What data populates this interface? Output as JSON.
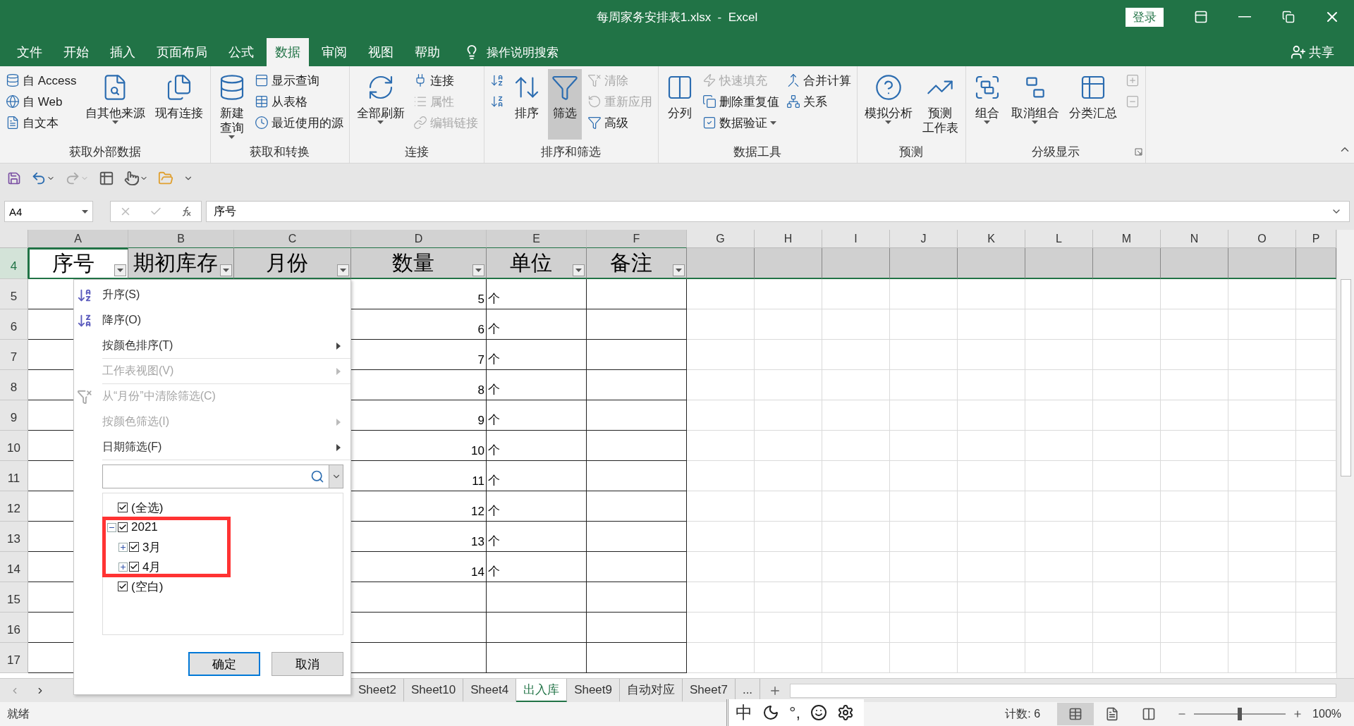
{
  "window": {
    "title": "每周家务安排表1.xlsx  -  Excel",
    "sign_in": "登录",
    "share": "共享"
  },
  "tabs": [
    {
      "label": "文件",
      "selected": false
    },
    {
      "label": "开始",
      "selected": false
    },
    {
      "label": "插入",
      "selected": false
    },
    {
      "label": "页面布局",
      "selected": false
    },
    {
      "label": "公式",
      "selected": false
    },
    {
      "label": "数据",
      "selected": true
    },
    {
      "label": "审阅",
      "selected": false
    },
    {
      "label": "视图",
      "selected": false
    },
    {
      "label": "帮助",
      "selected": false
    }
  ],
  "tell_me": "操作说明搜索",
  "ribbon": [
    {
      "name": "获取外部数据",
      "launcher": false,
      "columns": [
        {
          "kind": "stack",
          "items": [
            {
              "label": "自 Access",
              "disabled": false
            },
            {
              "label": "自 Web",
              "disabled": false
            },
            {
              "label": "自文本",
              "disabled": false
            }
          ]
        },
        {
          "kind": "large",
          "label": "自其他来源",
          "dropdown": true,
          "pressed": false,
          "disabled": false
        },
        {
          "kind": "large",
          "label": "现有连接",
          "dropdown": false,
          "pressed": false,
          "disabled": false
        }
      ]
    },
    {
      "name": "获取和转换",
      "launcher": false,
      "columns": [
        {
          "kind": "large",
          "lines": [
            "新建",
            "查询"
          ],
          "dropdown": true,
          "pressed": false,
          "disabled": false
        },
        {
          "kind": "stack",
          "items": [
            {
              "label": "显示查询",
              "disabled": false
            },
            {
              "label": "从表格",
              "disabled": false
            },
            {
              "label": "最近使用的源",
              "disabled": false
            }
          ]
        }
      ]
    },
    {
      "name": "连接",
      "launcher": false,
      "columns": [
        {
          "kind": "large",
          "label": "全部刷新",
          "dropdown": true,
          "pressed": false,
          "disabled": false
        },
        {
          "kind": "stack",
          "items": [
            {
              "label": "连接",
              "disabled": false
            },
            {
              "label": "属性",
              "disabled": true
            },
            {
              "label": "编辑链接",
              "disabled": true
            }
          ]
        }
      ]
    },
    {
      "name": "排序和筛选",
      "launcher": false,
      "columns": [
        {
          "kind": "stack",
          "items": [
            {
              "disabled": false
            },
            {
              "disabled": false
            }
          ]
        },
        {
          "kind": "large",
          "label": "排序",
          "dropdown": false,
          "pressed": false,
          "disabled": false
        },
        {
          "kind": "large",
          "label": "筛选",
          "dropdown": false,
          "pressed": true,
          "disabled": false
        },
        {
          "kind": "stack",
          "items": [
            {
              "label": "清除",
              "disabled": true
            },
            {
              "label": "重新应用",
              "disabled": true
            },
            {
              "label": "高级",
              "disabled": false
            }
          ]
        }
      ]
    },
    {
      "name": "数据工具",
      "launcher": false,
      "columns": [
        {
          "kind": "large",
          "label": "分列",
          "dropdown": false,
          "pressed": false,
          "disabled": false
        },
        {
          "kind": "stack",
          "items": [
            {
              "label": "快速填充",
              "disabled": true
            },
            {
              "label": "删除重复值",
              "disabled": false
            },
            {
              "label": "数据验证",
              "disabled": false,
              "dropdown": true
            }
          ]
        },
        {
          "kind": "stack",
          "items": [
            {
              "label": "合并计算",
              "disabled": false
            },
            {
              "label": "关系",
              "disabled": false
            }
          ]
        }
      ]
    },
    {
      "name": "预测",
      "launcher": false,
      "columns": [
        {
          "kind": "large",
          "label": "模拟分析",
          "dropdown": true,
          "pressed": false,
          "disabled": false
        },
        {
          "kind": "large",
          "lines": [
            "预测",
            "工作表"
          ],
          "dropdown": false,
          "pressed": false,
          "disabled": false
        }
      ]
    },
    {
      "name": "分级显示",
      "launcher": true,
      "columns": [
        {
          "kind": "large",
          "label": "组合",
          "dropdown": true,
          "pressed": false,
          "disabled": false
        },
        {
          "kind": "large",
          "label": "取消组合",
          "dropdown": true,
          "pressed": false,
          "disabled": false
        },
        {
          "kind": "large",
          "label": "分类汇总",
          "dropdown": false,
          "pressed": false,
          "disabled": false
        },
        {
          "kind": "stack",
          "items": [
            {
              "disabled": true
            },
            {
              "disabled": true
            }
          ]
        }
      ]
    }
  ],
  "formula_bar": {
    "name_box": "A4",
    "content": "序号"
  },
  "columns": [
    "A",
    "B",
    "C",
    "D",
    "E",
    "F",
    "G",
    "H",
    "I",
    "J",
    "K",
    "L",
    "M",
    "N",
    "O",
    "P"
  ],
  "header_row": {
    "number": "4",
    "cells": [
      {
        "text": "序号",
        "selected": true
      },
      {
        "text": "期初库存",
        "selected": false
      },
      {
        "text": "月份",
        "selected": false
      },
      {
        "text": "数量",
        "selected": false
      },
      {
        "text": "单位",
        "selected": false
      },
      {
        "text": "备注",
        "selected": false
      }
    ]
  },
  "rows": [
    {
      "number": "5",
      "quantity": "5",
      "unit": "个"
    },
    {
      "number": "6",
      "quantity": "6",
      "unit": "个"
    },
    {
      "number": "7",
      "quantity": "7",
      "unit": "个"
    },
    {
      "number": "8",
      "quantity": "8",
      "unit": "个"
    },
    {
      "number": "9",
      "quantity": "9",
      "unit": "个"
    },
    {
      "number": "10",
      "quantity": "10",
      "unit": "个"
    },
    {
      "number": "11",
      "quantity": "11",
      "unit": "个"
    },
    {
      "number": "12",
      "quantity": "12",
      "unit": "个"
    },
    {
      "number": "13",
      "quantity": "13",
      "unit": "个"
    },
    {
      "number": "14",
      "quantity": "14",
      "unit": "个"
    },
    {
      "number": "15"
    },
    {
      "number": "16"
    },
    {
      "number": "17"
    }
  ],
  "filter_menu": {
    "items": [
      {
        "label": "升序(S)",
        "kind": "sort_asc",
        "disabled": false,
        "submenu": false,
        "separator_after": false
      },
      {
        "label": "降序(O)",
        "kind": "sort_desc",
        "disabled": false,
        "submenu": false,
        "separator_after": false
      },
      {
        "label": "按颜色排序(T)",
        "kind": "plain",
        "disabled": false,
        "submenu": true,
        "separator_after": true
      },
      {
        "label": "工作表视图(V)",
        "kind": "plain",
        "disabled": true,
        "submenu": true,
        "separator_after": true
      },
      {
        "label": "从“月份”中清除筛选(C)",
        "kind": "clear_filter",
        "disabled": true,
        "submenu": false,
        "separator_after": false
      },
      {
        "label": "按颜色筛选(I)",
        "kind": "plain",
        "disabled": true,
        "submenu": true,
        "separator_after": false
      },
      {
        "label": "日期筛选(F)",
        "kind": "plain",
        "disabled": false,
        "submenu": true,
        "separator_after": true
      }
    ],
    "tree": [
      {
        "label": "(全选)",
        "checked": true
      },
      {
        "label": "2021",
        "checked": true,
        "expanded": true,
        "children": [
          {
            "label": "3月",
            "checked": true,
            "expanded": false
          },
          {
            "label": "4月",
            "checked": true,
            "expanded": false
          }
        ]
      },
      {
        "label": "(空白)",
        "checked": true
      }
    ],
    "buttons": [
      {
        "label": "确定",
        "default": true
      },
      {
        "label": "取消",
        "default": false
      }
    ]
  },
  "sheet_tabs": [
    {
      "label": "Sheet2",
      "selected": false
    },
    {
      "label": "Sheet10",
      "selected": false
    },
    {
      "label": "Sheet4",
      "selected": false
    },
    {
      "label": "出入库",
      "selected": true
    },
    {
      "label": "Sheet9",
      "selected": false
    },
    {
      "label": "自动对应",
      "selected": false
    },
    {
      "label": "Sheet7",
      "selected": false
    }
  ],
  "more_sheets": "...",
  "ime": {
    "mode": "中",
    "punct": "°,"
  },
  "status": {
    "ready": "就绪",
    "count": "计数: 6",
    "zoom": "100%",
    "zoom_slider": {
      "level": 0.5
    },
    "views": [
      {
        "kind": "normal",
        "selected": true
      },
      {
        "kind": "page_layout",
        "selected": false
      },
      {
        "kind": "page_break",
        "selected": false
      }
    ]
  }
}
